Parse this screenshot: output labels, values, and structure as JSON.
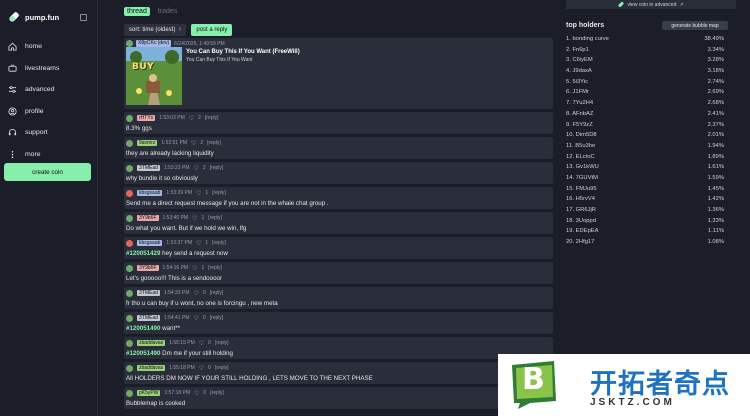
{
  "app": {
    "name": "pump.fun"
  },
  "sidebar": {
    "items": [
      {
        "label": "home",
        "icon": "home-icon"
      },
      {
        "label": "livestreams",
        "icon": "tv-icon"
      },
      {
        "label": "advanced",
        "icon": "sliders-icon"
      },
      {
        "label": "profile",
        "icon": "user-icon"
      },
      {
        "label": "support",
        "icon": "headset-icon"
      },
      {
        "label": "more",
        "icon": "more-icon"
      }
    ],
    "create_label": "create coin"
  },
  "tabs": {
    "thread": "thread",
    "trades": "trades"
  },
  "toolbar": {
    "sort_label": "sort: time (oldest)",
    "post_label": "post a reply"
  },
  "op": {
    "user": "X8pCKc (dev)",
    "time": "6/24/2025, 1:49:59 PM",
    "title": "You Can Buy This If You Want (FreeWill)",
    "description": "You Can Buy This If You Want",
    "image_text": "BUY"
  },
  "replies": [
    {
      "user": "rHTYs",
      "user_color": "#e7a7a7",
      "avatar_color": "#6fa86b",
      "time": "1:53:03 PM",
      "likes": "2",
      "reply": "[reply]",
      "ref": "",
      "text": "8.3% ggs"
    },
    {
      "user": "9avmrz",
      "user_color": "#9ad178",
      "avatar_color": "#6fa86b",
      "time": "1:52:51 PM",
      "likes": "2",
      "reply": "[reply]",
      "ref": "",
      "text": "they are already lacking liquidity"
    },
    {
      "user": "3TMEad",
      "user_color": "#c3c6cf",
      "avatar_color": "#6fa86b",
      "time": "1:53:23 PM",
      "likes": "2",
      "reply": "[reply]",
      "ref": "",
      "text": "why bundle it so obviously"
    },
    {
      "user": "kbsgsaab",
      "user_color": "#a6b8e8",
      "avatar_color": "#e5645a",
      "time": "1:53:29 PM",
      "likes": "1",
      "reply": "[reply]",
      "ref": "",
      "text": "Send me a direct request message if you are not in the whale chat group ."
    },
    {
      "user": "3Y9b6F",
      "user_color": "#e7a7a7",
      "avatar_color": "#6fa86b",
      "time": "1:53:45 PM",
      "likes": "1",
      "reply": "[reply]",
      "ref": "",
      "text": "Do what you want. But if we hold we win, lfg"
    },
    {
      "user": "kbsgsaab",
      "user_color": "#a6b8e8",
      "avatar_color": "#e5645a",
      "time": "1:53:37 PM",
      "likes": "1",
      "reply": "[reply]",
      "ref": "#120051429",
      "text": " hey send a request now"
    },
    {
      "user": "3Y9b6F",
      "user_color": "#e7a7a7",
      "avatar_color": "#6fa86b",
      "time": "1:54:16 PM",
      "likes": "1",
      "reply": "[reply]",
      "ref": "",
      "text": "Let's gooooo!!! This is a sendoooor"
    },
    {
      "user": "3TMEad",
      "user_color": "#c3c6cf",
      "avatar_color": "#6fa86b",
      "time": "1:54:33 PM",
      "likes": "0",
      "reply": "[reply]",
      "ref": "",
      "text": "fr tho u can buy if u wont, no one is forcingu , new meta"
    },
    {
      "user": "3TMEad",
      "user_color": "#c3c6cf",
      "avatar_color": "#6fa86b",
      "time": "1:54:41 PM",
      "likes": "0",
      "reply": "[reply]",
      "ref": "#120051490",
      "text": " want**"
    },
    {
      "user": "zbaddavas",
      "user_color": "#9ad178",
      "avatar_color": "#6fa86b",
      "time": "1:55:15 PM",
      "likes": "0",
      "reply": "[reply]",
      "ref": "#120051490",
      "text": " Dm me if your still holding"
    },
    {
      "user": "zbaddavas",
      "user_color": "#9ad178",
      "avatar_color": "#6fa86b",
      "time": "1:55:18 PM",
      "likes": "0",
      "reply": "[reply]",
      "ref": "",
      "text": "All HOLDERS DM NOW IF YOUR STILL HOLDING , LETS MOVE TO THE NEXT PHASE"
    },
    {
      "user": "pK5yPW",
      "user_color": "#9ad178",
      "avatar_color": "#6fa86b",
      "time": "1:57:18 PM",
      "likes": "0",
      "reply": "[reply]",
      "ref": "",
      "text": "Bubblemap is cooked"
    }
  ],
  "right": {
    "advanced_link": "view coin in advanced",
    "top_holders_title": "top holders",
    "bubble_button": "generate bubble map",
    "holders": [
      {
        "name": "1. bonding curve",
        "pct": "38.49%"
      },
      {
        "name": "2. Fn6p1",
        "pct": "3.34%"
      },
      {
        "name": "3. C6iyEM",
        "pct": "3.28%"
      },
      {
        "name": "4. J9daxA",
        "pct": "3.18%"
      },
      {
        "name": "5. 5i3Yic",
        "pct": "2.74%"
      },
      {
        "name": "6. J1FMr",
        "pct": "2.69%"
      },
      {
        "name": "7. 7Yu2H4",
        "pct": "2.68%"
      },
      {
        "name": "8. AFnbAZ",
        "pct": "2.41%"
      },
      {
        "name": "9. F5Y9zZ",
        "pct": "2.37%"
      },
      {
        "name": "10. Dim5D8",
        "pct": "2.01%"
      },
      {
        "name": "11. B5u3he",
        "pct": "1.94%"
      },
      {
        "name": "12. ELctoC",
        "pct": "1.89%"
      },
      {
        "name": "13. Gv1kWU",
        "pct": "1.61%"
      },
      {
        "name": "14. 7GUVtM",
        "pct": "1.59%"
      },
      {
        "name": "15. FMJu95",
        "pct": "1.45%"
      },
      {
        "name": "16. H5rvV4",
        "pct": "1.42%"
      },
      {
        "name": "17. GR6JjR",
        "pct": "1.36%"
      },
      {
        "name": "18. 3Uoppd",
        "pct": "1.33%"
      },
      {
        "name": "19. EDEpEA",
        "pct": "1.11%"
      },
      {
        "name": "20. 2Hfg17",
        "pct": "1.08%"
      }
    ]
  },
  "watermark": {
    "text": "开拓者奇点",
    "site": "JSKTZ.COM",
    "logo_letter": "B"
  }
}
